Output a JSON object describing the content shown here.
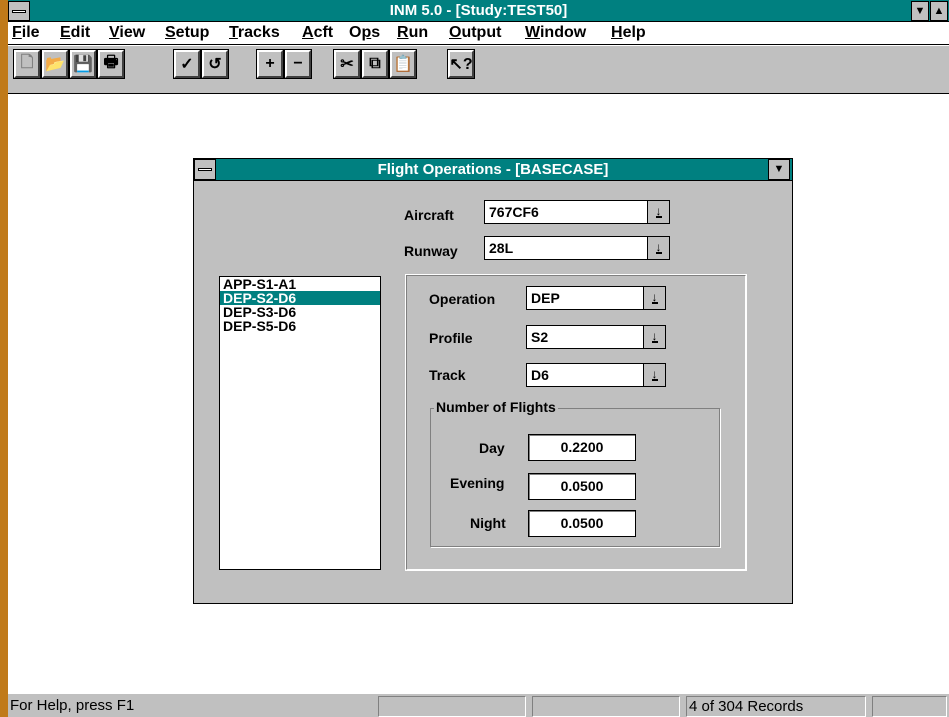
{
  "app": {
    "title": "INM 5.0 - [Study:TEST50]"
  },
  "menu": [
    "File",
    "Edit",
    "View",
    "Setup",
    "Tracks",
    "Acft",
    "Ops",
    "Run",
    "Output",
    "Window",
    "Help"
  ],
  "menu_underline": [
    "F",
    "E",
    "V",
    "S",
    "T",
    "A",
    "p",
    "R",
    "O",
    "W",
    "H"
  ],
  "toolbar": {
    "icons": [
      "new-file-icon",
      "open-folder-icon",
      "save-disk-icon",
      "print-icon",
      "check-icon",
      "undo-icon",
      "plus-icon",
      "minus-icon",
      "cut-icon",
      "copy-icon",
      "paste-icon",
      "context-help-icon"
    ]
  },
  "dialog": {
    "title": "Flight Operations - [BASECASE]",
    "aircraft_label": "Aircraft",
    "aircraft_value": "767CF6",
    "runway_label": "Runway",
    "runway_value": "28L",
    "list": [
      "APP-S1-A1",
      "DEP-S2-D6",
      "DEP-S3-D6",
      "DEP-S5-D6"
    ],
    "selected_index": 1,
    "operation_label": "Operation",
    "operation_value": "DEP",
    "profile_label": "Profile",
    "profile_value": "S2",
    "track_label": "Track",
    "track_value": "D6",
    "flights_group": "Number of Flights",
    "day_label": "Day",
    "day_value": "0.2200",
    "evening_label": "Evening",
    "evening_value": "0.0500",
    "night_label": "Night",
    "night_value": "0.0500"
  },
  "status": {
    "help": "For Help, press F1",
    "records": "4 of 304 Records"
  },
  "colors": {
    "titlebar": "#008080",
    "face": "#c0c0c0",
    "frame": "#c07a1a"
  }
}
